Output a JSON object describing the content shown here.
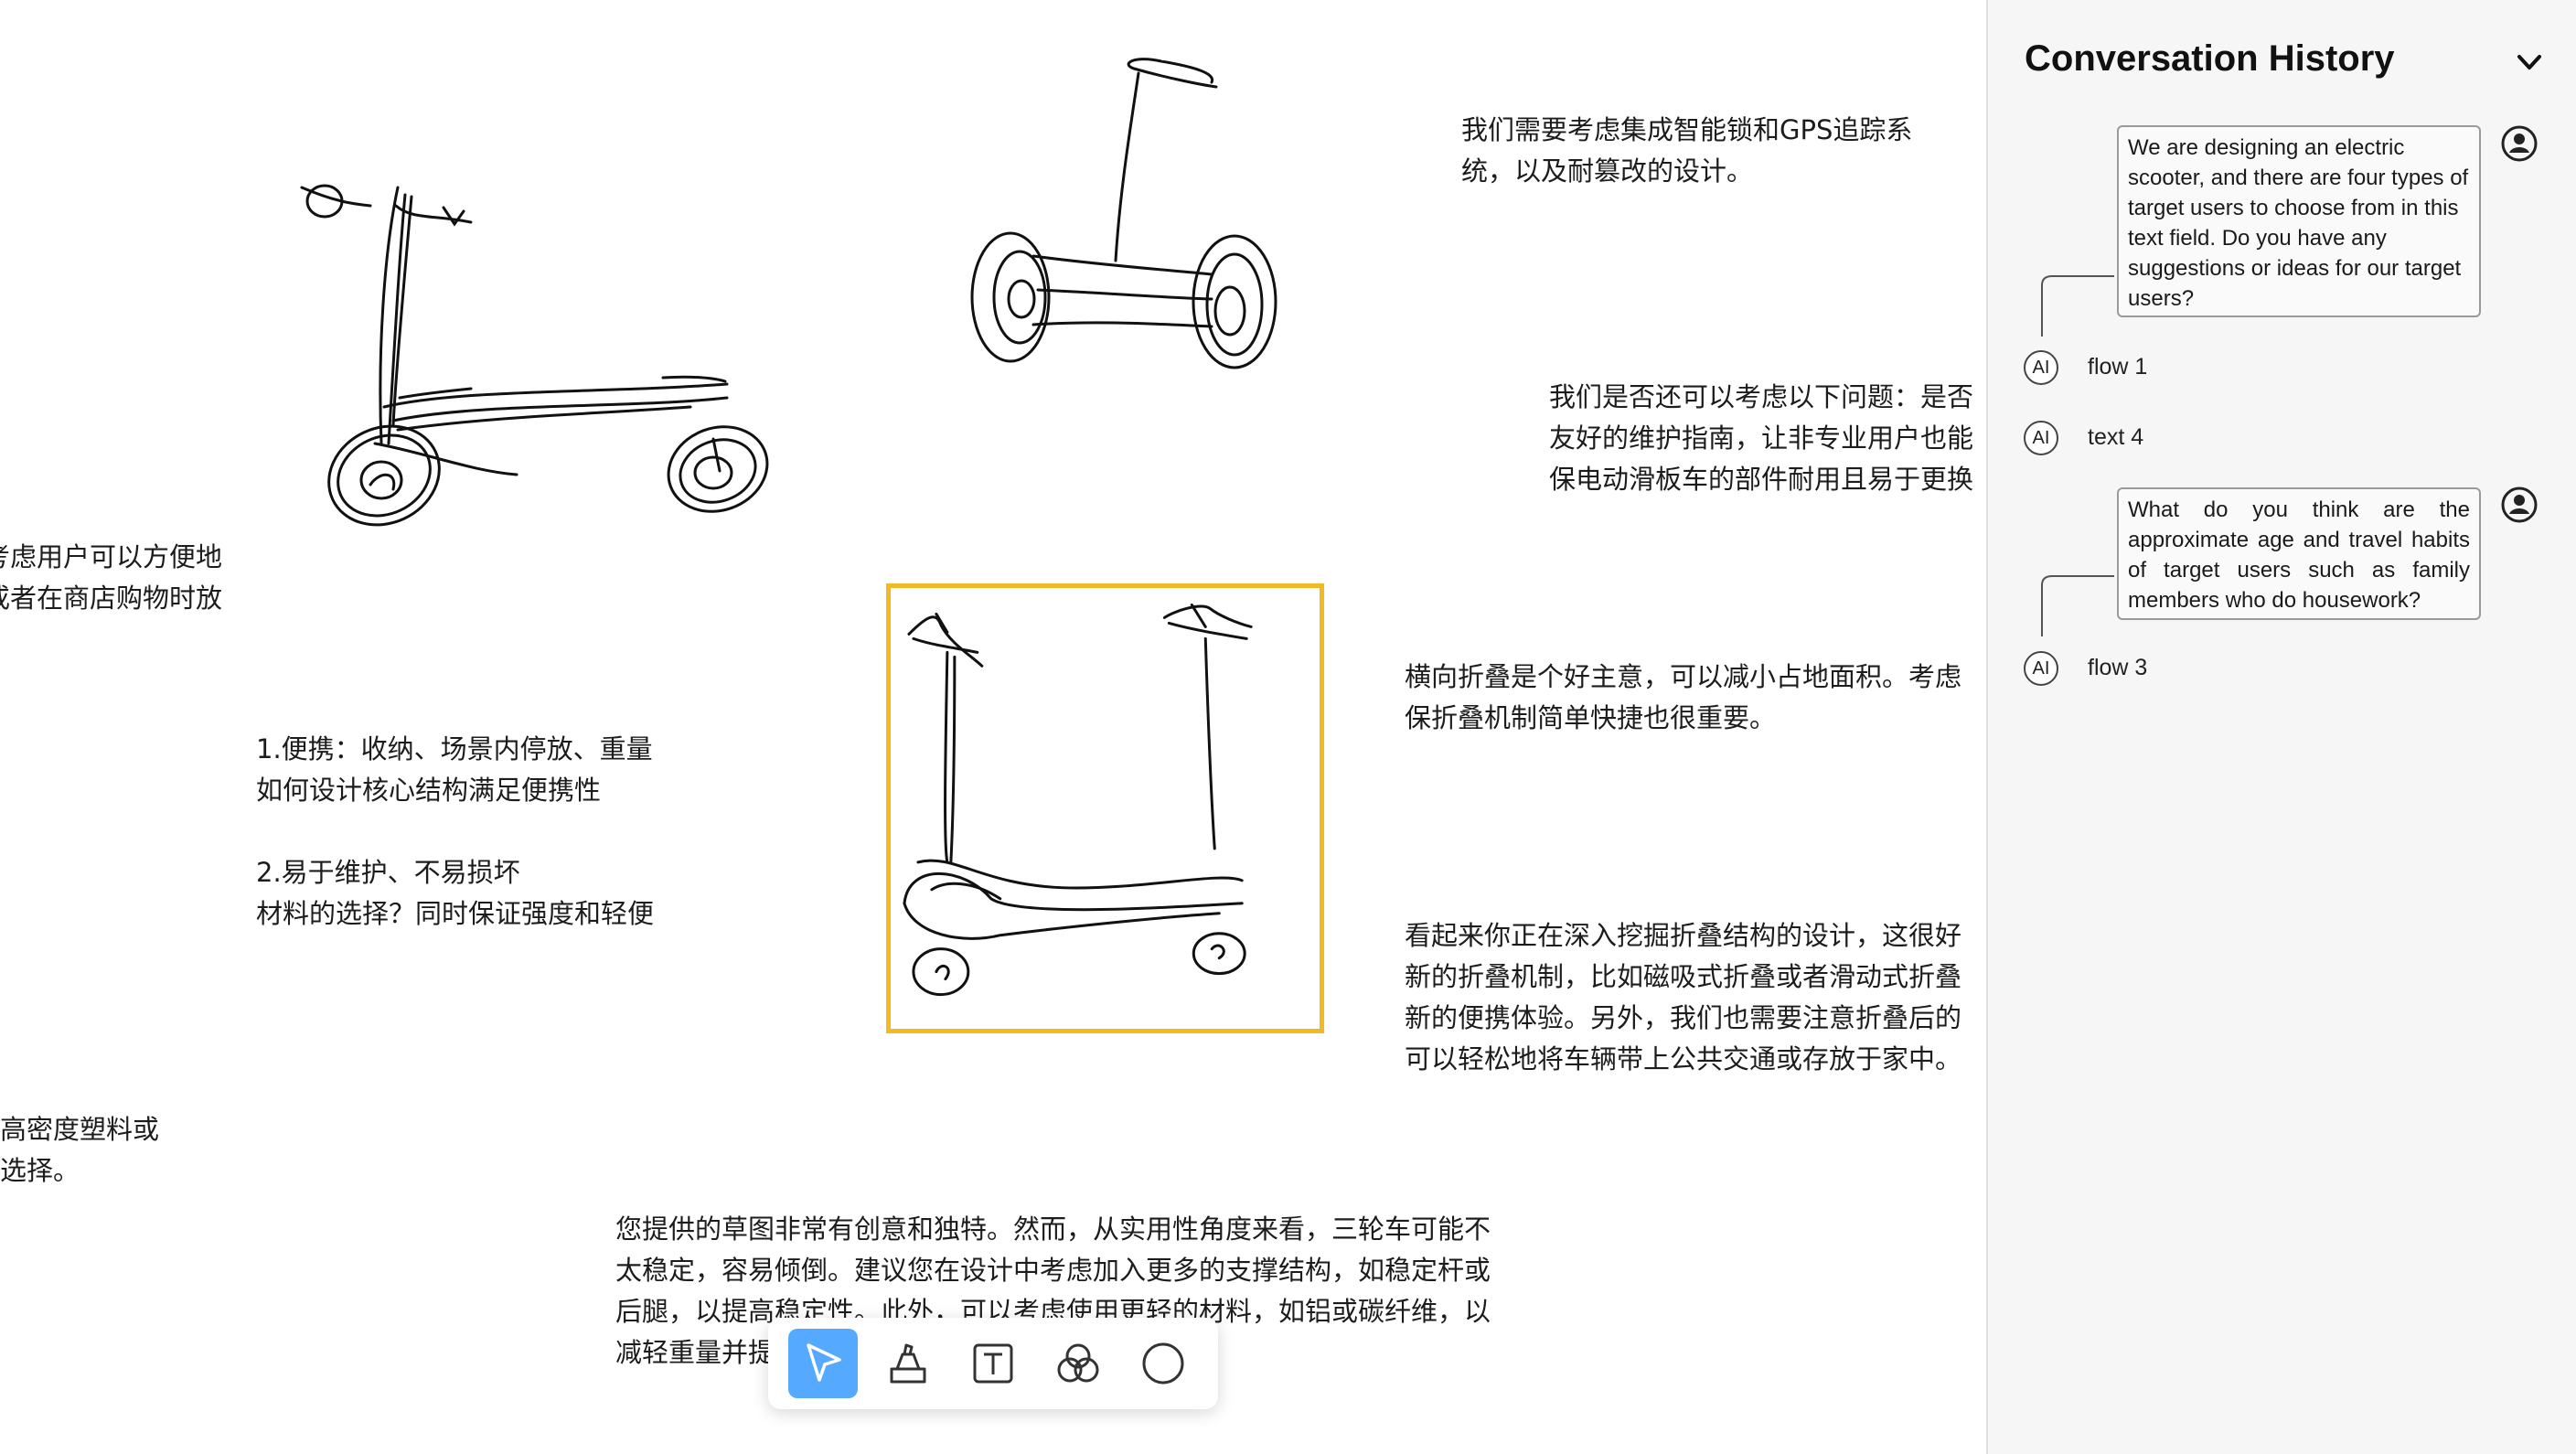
{
  "canvas": {
    "notes": [
      {
        "id": "smart-lock-note",
        "text": "我们需要考虑集成智能锁和GPS追踪系\n统，以及耐篡改的设计。"
      },
      {
        "id": "maintenance-note",
        "text": "我们是否还可以考虑以下问题：是否\n友好的维护指南，让非专业用户也能\n保电动滑板车的部件耐用且易于更换"
      },
      {
        "id": "user-convenience-note",
        "text": "考虑用户可以方便地\n或者在商店购物时放"
      },
      {
        "id": "folding-note",
        "text": "横向折叠是个好主意，可以减小占地面积。考虑\n保折叠机制简单快捷也很重要。"
      },
      {
        "id": "portability-note",
        "text": "1.便携：收纳、场景内停放、重量\n如何设计核心结构满足便携性\n\n2.易于维护、不易损坏\n材料的选择？同时保证强度和轻便"
      },
      {
        "id": "folding-structure-note",
        "text": "看起来你正在深入挖掘折叠结构的设计，这很好\n新的折叠机制，比如磁吸式折叠或者滑动式折叠\n新的便携体验。另外，我们也需要注意折叠后的\n可以轻松地将车辆带上公共交通或存放于家中。"
      },
      {
        "id": "material-note",
        "text": "高密度塑料或\n选择。"
      },
      {
        "id": "tricycle-feedback-note",
        "text": "您提供的草图非常有创意和独特。然而，从实用性角度来看，三轮车可能不\n太稳定，容易倾倒。建议您在设计中考虑加入更多的支撑结构，如稳定杆或\n后腿，以提高稳定性。此外，可以考虑使用更轻的材料，如铝或碳纤维，以\n减轻重量并提高便携性。"
      }
    ]
  },
  "toolbar": {
    "tools": [
      {
        "name": "select-tool",
        "icon": "cursor-arrow-icon",
        "active": true
      },
      {
        "name": "sketch-tool",
        "icon": "stamp-icon",
        "active": false
      },
      {
        "name": "text-tool",
        "icon": "text-box-icon",
        "active": false
      },
      {
        "name": "blend-tool",
        "icon": "overlapping-circles-icon",
        "active": false
      },
      {
        "name": "shape-tool",
        "icon": "circle-icon",
        "active": false
      }
    ],
    "active_color": "#55a9ff"
  },
  "panel": {
    "title": "Conversation History",
    "messages": [
      {
        "role": "user",
        "text": "We are designing an electric scooter, and there are four types of target users to choose from in this text field. Do you have any suggestions or ideas for our target users?"
      },
      {
        "role": "ai",
        "badge": "AI",
        "label": "flow 1"
      },
      {
        "role": "ai",
        "badge": "AI",
        "label": "text 4"
      },
      {
        "role": "user",
        "text": "What do you think are the approximate age and travel habits of target users such as family members who do housework?"
      },
      {
        "role": "ai",
        "badge": "AI",
        "label": "flow 3"
      }
    ]
  },
  "colors": {
    "selection_border": "#f2b922",
    "panel_background": "#f6f6f6"
  }
}
